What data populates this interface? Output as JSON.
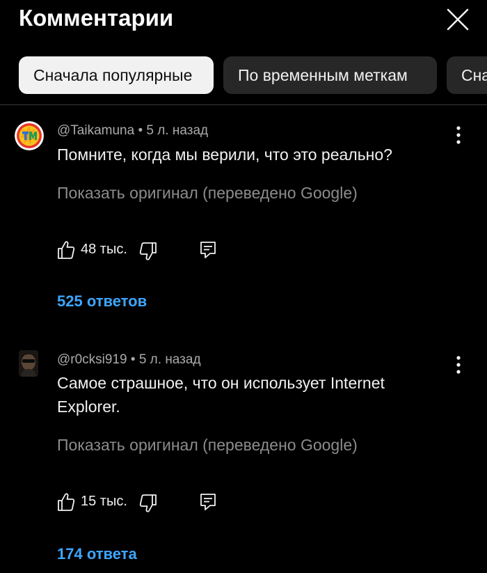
{
  "header": {
    "title": "Комментарии",
    "close_icon": "close-icon"
  },
  "filters": [
    {
      "label": "Сначала популярные",
      "selected": true
    },
    {
      "label": "По временным меткам",
      "selected": false
    },
    {
      "label": "Сна",
      "selected": false
    }
  ],
  "comments": [
    {
      "author": "@Taikamuna",
      "time": "5 л. назад",
      "text": "Помните, когда мы верили, что это реально?",
      "translate_label": "Показать оригинал (переведено Google)",
      "likes": "48 тыс.",
      "replies_label": "525 ответов",
      "avatar_icon": "tm-logo-avatar"
    },
    {
      "author": "@r0cksi919",
      "time": "5 л. назад",
      "text": "Самое страшное, что он использует Internet Explorer.",
      "translate_label": "Показать оригинал (переведено Google)",
      "likes": "15 тыс.",
      "replies_label": "174 ответа",
      "avatar_icon": "user-photo-avatar"
    }
  ],
  "colors": {
    "background": "#000000",
    "link": "#3ea6ff",
    "secondary_text": "#aaaaaa",
    "chip_active_bg": "#f1f1f1",
    "chip_inactive_bg": "#272727"
  }
}
